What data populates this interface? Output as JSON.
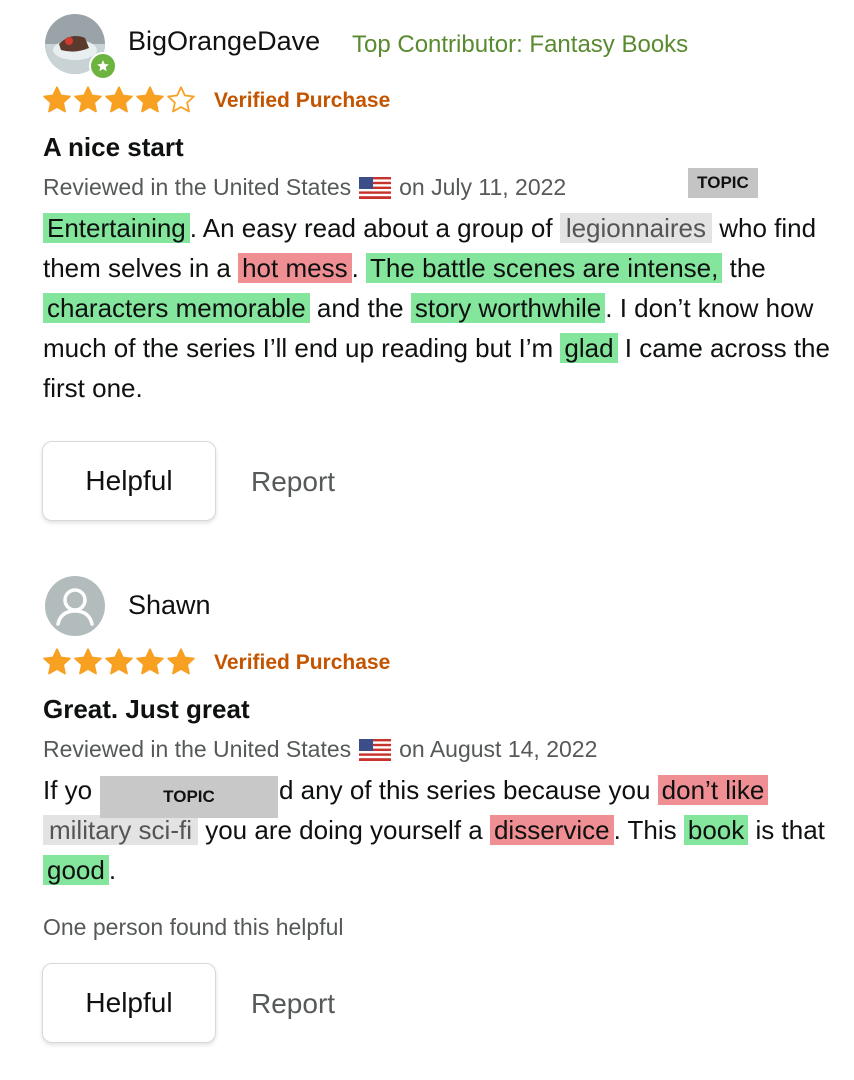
{
  "reviews": [
    {
      "username": "BigOrangeDave",
      "contributor": "Top Contributor: Fantasy Books",
      "rating": 4,
      "rating_max": 5,
      "verified": "Verified Purchase",
      "title": "A nice start",
      "meta": {
        "prefix": "Reviewed in the United States",
        "flag_icon": "us-flag-icon",
        "date": "on July 11, 2022"
      },
      "topic_tag": "TOPIC",
      "body": [
        {
          "text": "Entertaining",
          "hl": "positive"
        },
        {
          "text": ". An easy read about a group of ",
          "hl": ""
        },
        {
          "text": "legionnaires",
          "hl": "topic"
        },
        {
          "text": " who find them selves in a ",
          "hl": ""
        },
        {
          "text": "hot mess",
          "hl": "negative"
        },
        {
          "text": ". ",
          "hl": ""
        },
        {
          "text": "The battle scenes are intense,",
          "hl": "positive"
        },
        {
          "text": " the ",
          "hl": ""
        },
        {
          "text": "characters memorable",
          "hl": "positive"
        },
        {
          "text": " and the ",
          "hl": ""
        },
        {
          "text": "story worthwhile",
          "hl": "positive"
        },
        {
          "text": ". I don’t know how much of the series I’ll end up reading but I’m ",
          "hl": ""
        },
        {
          "text": "glad",
          "hl": "positive"
        },
        {
          "text": " I came across the first one.",
          "hl": ""
        }
      ],
      "helpful_label": "Helpful",
      "report_label": "Report"
    },
    {
      "username": "Shawn",
      "rating": 5,
      "rating_max": 5,
      "verified": "Verified Purchase",
      "title": "Great. Just great",
      "meta": {
        "prefix": "Reviewed in the United States",
        "flag_icon": "us-flag-icon",
        "date": "on August 14, 2022"
      },
      "topic_tag": "TOPIC",
      "body_prefix": "If yo",
      "body": [
        {
          "text": "d any of this series because you ",
          "hl": ""
        },
        {
          "text": "don’t like",
          "hl": "negative"
        },
        {
          "text": " ",
          "hl": ""
        },
        {
          "text": "military sci-fi",
          "hl": "topic"
        },
        {
          "text": " you are doing yourself a ",
          "hl": ""
        },
        {
          "text": "disservice",
          "hl": "negative"
        },
        {
          "text": ". This ",
          "hl": ""
        },
        {
          "text": "book",
          "hl": "positive"
        },
        {
          "text": " is that ",
          "hl": ""
        },
        {
          "text": "good",
          "hl": "positive"
        },
        {
          "text": ".",
          "hl": ""
        }
      ],
      "found_helpful": "One person found this helpful",
      "helpful_label": "Helpful",
      "report_label": "Report"
    }
  ],
  "colors": {
    "positive": "#84e69c",
    "negative": "#ef8f94",
    "topic": "#e3e3e3",
    "star": "#f7a021",
    "verified": "#c45500",
    "contributor": "#5a8a2f"
  }
}
